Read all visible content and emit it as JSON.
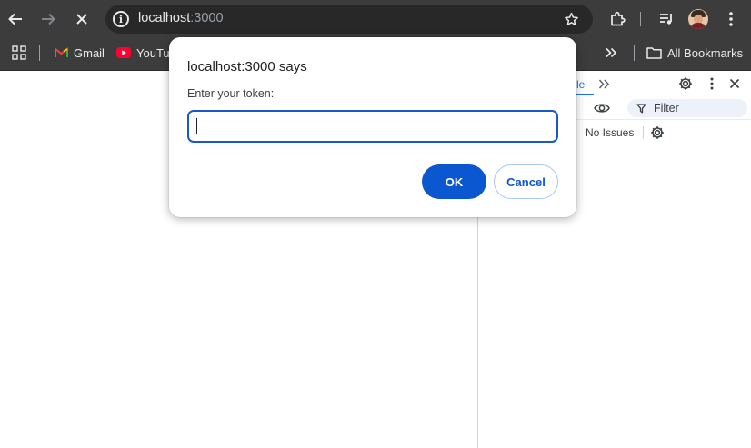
{
  "browser": {
    "url_host": "localhost",
    "url_port": ":3000",
    "icons": {
      "back": "arrow-left-icon",
      "forward": "arrow-right-icon",
      "stop": "close-icon",
      "site_info": "info-icon",
      "bookmark_star": "star-icon",
      "extensions": "puzzle-icon",
      "media": "playlist-icon",
      "menu": "more-vertical-icon"
    },
    "colors": {
      "toolbar": "#3c3c3c",
      "omnibox": "#282828"
    }
  },
  "bookmarks": {
    "items": [
      {
        "label": "Gmail",
        "icon": "gmail-icon"
      },
      {
        "label": "YouTu",
        "icon": "youtube-icon"
      }
    ],
    "overflow_icon": "chevron-double-right-icon",
    "all_bookmarks_label": "All Bookmarks"
  },
  "devtools": {
    "tab_label": "le",
    "filter_placeholder": "Filter",
    "issues_label": "No Issues"
  },
  "dialog": {
    "title": "localhost:3000 says",
    "message": "Enter your token:",
    "input_value": "",
    "ok_label": "OK",
    "cancel_label": "Cancel",
    "accent": "#0b57d0"
  }
}
